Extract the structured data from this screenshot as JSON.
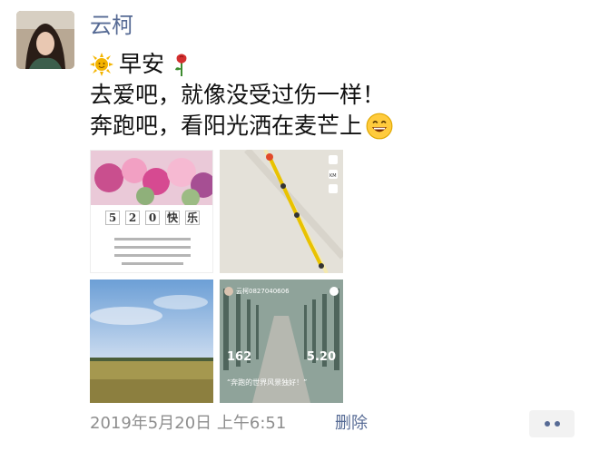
{
  "post": {
    "username": "云柯",
    "line1": "早安",
    "line2": "去爱吧，就像没受过伤一样！",
    "line3": "奔跑吧，看阳光洒在麦芒上",
    "emoji_sun": "sun-face-icon",
    "emoji_rose": "rose-icon",
    "emoji_smile": "grinning-face-icon"
  },
  "photos": {
    "card520": {
      "chars": [
        "5",
        "2",
        "0",
        "快",
        "乐"
      ]
    },
    "map": {
      "badge1": "KM"
    },
    "run": {
      "runner": "云柯0827040606",
      "distance_value": "162",
      "time_value": "5.20",
      "slogan": "“奔跑的世界风景独好！”"
    }
  },
  "footer": {
    "timestamp": "2019年5月20日 上午6:51",
    "delete_label": "删除"
  },
  "colors": {
    "link": "#576b95",
    "meta": "#8e8e8e"
  }
}
